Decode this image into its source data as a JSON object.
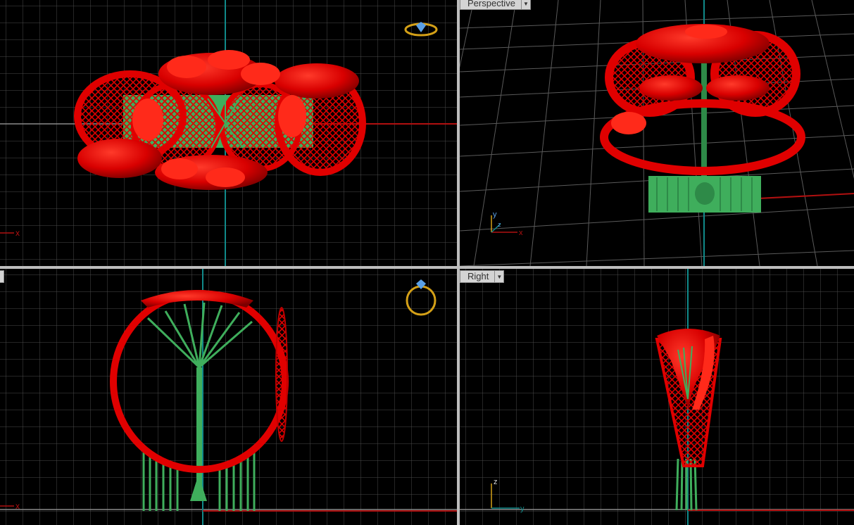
{
  "viewports": {
    "top": {
      "name": "",
      "axis_h": "x"
    },
    "perspective": {
      "name": "Perspective",
      "axis_v": "y",
      "axis_h": "x",
      "axis_d": "z"
    },
    "front": {
      "name": "",
      "axis_h": "x"
    },
    "right": {
      "name": "Right",
      "axis_v": "z",
      "axis_h": "y"
    }
  },
  "dropdown_glyph": "▼",
  "colors": {
    "background": "#000000",
    "grid": "#4a4a4a",
    "grid_major": "#7a7a7a",
    "axis_x": "#b01010",
    "axis_y": "#108a8a",
    "model_red": "#e00000",
    "support_green": "#3fae5c",
    "icon_gold": "#d4a017",
    "icon_blue": "#5aa0e6"
  }
}
